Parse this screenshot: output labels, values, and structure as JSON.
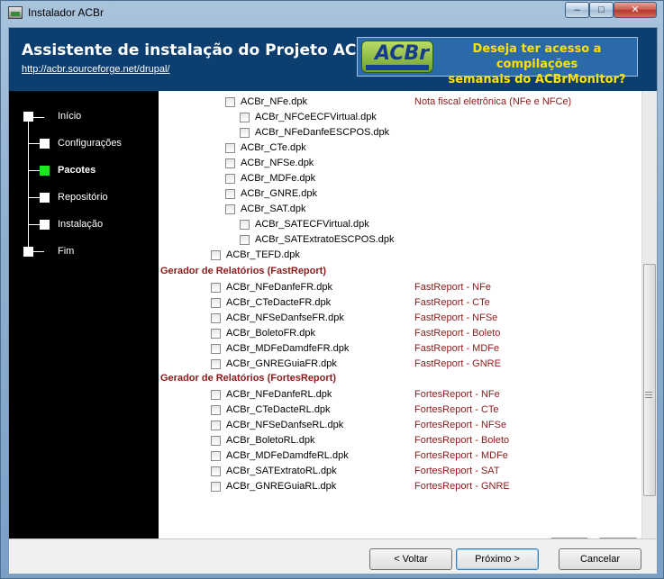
{
  "window": {
    "title": "Instalador ACBr",
    "minimize": "‒",
    "maximize": "□",
    "close": "✕"
  },
  "header": {
    "title": "Assistente de instalação do Projeto ACBr",
    "link": "http://acbr.sourceforge.net/drupal/",
    "banner_logo": "ACBr",
    "banner_line1": "Deseja ter acesso a compilações",
    "banner_line2": "semanais do ACBrMonitor?"
  },
  "steps": [
    {
      "label": "Início",
      "active": false
    },
    {
      "label": "Configurações",
      "active": false
    },
    {
      "label": "Pacotes",
      "active": true
    },
    {
      "label": "Repositório",
      "active": false
    },
    {
      "label": "Instalação",
      "active": false
    },
    {
      "label": "Fim",
      "active": false
    }
  ],
  "packages": {
    "nfe_group": [
      {
        "label": "ACBr_NFe.dpk",
        "desc": "Nota fiscal eletrônica (NFe e NFCe)"
      },
      {
        "label": "ACBr_NFCeECFVirtual.dpk",
        "desc": ""
      },
      {
        "label": "ACBr_NFeDanfeESCPOS.dpk",
        "desc": ""
      },
      {
        "label": "ACBr_CTe.dpk",
        "desc": ""
      },
      {
        "label": "ACBr_NFSe.dpk",
        "desc": ""
      },
      {
        "label": "ACBr_MDFe.dpk",
        "desc": ""
      },
      {
        "label": "ACBr_GNRE.dpk",
        "desc": ""
      },
      {
        "label": "ACBr_SAT.dpk",
        "desc": ""
      },
      {
        "label": "ACBr_SATECFVirtual.dpk",
        "desc": ""
      },
      {
        "label": "ACBr_SATExtratoESCPOS.dpk",
        "desc": ""
      },
      {
        "label": "ACBr_TEFD.dpk",
        "desc": ""
      }
    ],
    "fast_title": "Gerador de Relatórios (FastReport)",
    "fast": [
      {
        "label": "ACBr_NFeDanfeFR.dpk",
        "desc": "FastReport - NFe"
      },
      {
        "label": "ACBr_CTeDacteFR.dpk",
        "desc": "FastReport - CTe"
      },
      {
        "label": "ACBr_NFSeDanfseFR.dpk",
        "desc": "FastReport - NFSe"
      },
      {
        "label": "ACBr_BoletoFR.dpk",
        "desc": "FastReport - Boleto"
      },
      {
        "label": "ACBr_MDFeDamdfeFR.dpk",
        "desc": "FastReport - MDFe"
      },
      {
        "label": "ACBr_GNREGuiaFR.dpk",
        "desc": "FastReport - GNRE"
      }
    ],
    "fortes_title": "Gerador de Relatórios (FortesReport)",
    "fortes": [
      {
        "label": "ACBr_NFeDanfeRL.dpk",
        "desc": "FortesReport - NFe"
      },
      {
        "label": "ACBr_CTeDacteRL.dpk",
        "desc": "FortesReport - CTe"
      },
      {
        "label": "ACBr_NFSeDanfseRL.dpk",
        "desc": "FortesReport - NFSe"
      },
      {
        "label": "ACBr_BoletoRL.dpk",
        "desc": "FortesReport - Boleto"
      },
      {
        "label": "ACBr_MDFeDamdfeRL.dpk",
        "desc": "FortesReport - MDFe"
      },
      {
        "label": "ACBr_SATExtratoRL.dpk",
        "desc": "FortesReport - SAT"
      },
      {
        "label": "ACBr_GNREGuiaRL.dpk",
        "desc": "FortesReport - GNRE"
      }
    ]
  },
  "actions": {
    "uncheck_all": "✖",
    "check_all": "✔"
  },
  "footer": {
    "back": "< Voltar",
    "next": "Próximo >",
    "cancel": "Cancelar"
  }
}
